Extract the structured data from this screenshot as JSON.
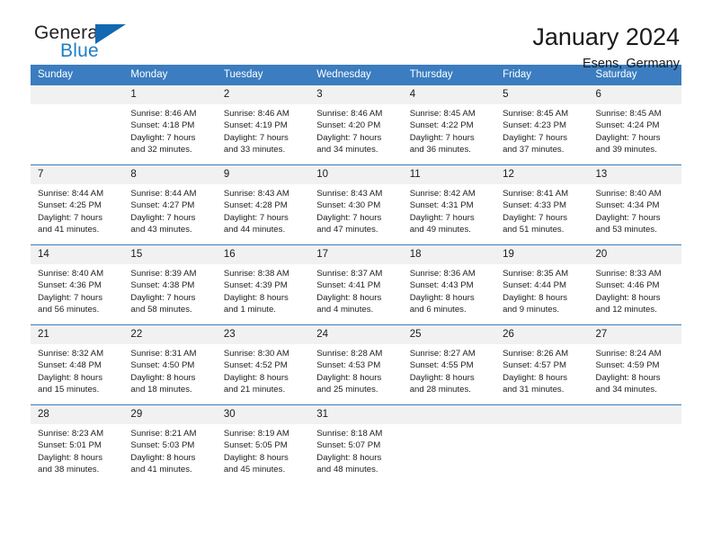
{
  "brand": {
    "name_part1": "General",
    "name_part2": "Blue",
    "accent_color": "#1268b3",
    "text_color": "#231f20"
  },
  "header": {
    "title": "January 2024",
    "subtitle": "Esens, Germany"
  },
  "calendar": {
    "header_bg": "#3b7dc0",
    "daynum_bg": "#f1f1f1",
    "weekdays": [
      "Sunday",
      "Monday",
      "Tuesday",
      "Wednesday",
      "Thursday",
      "Friday",
      "Saturday"
    ],
    "weeks": [
      [
        {
          "day": "",
          "blank": true
        },
        {
          "day": "1",
          "sunrise": "Sunrise: 8:46 AM",
          "sunset": "Sunset: 4:18 PM",
          "daylight_line1": "Daylight: 7 hours",
          "daylight_line2": "and 32 minutes."
        },
        {
          "day": "2",
          "sunrise": "Sunrise: 8:46 AM",
          "sunset": "Sunset: 4:19 PM",
          "daylight_line1": "Daylight: 7 hours",
          "daylight_line2": "and 33 minutes."
        },
        {
          "day": "3",
          "sunrise": "Sunrise: 8:46 AM",
          "sunset": "Sunset: 4:20 PM",
          "daylight_line1": "Daylight: 7 hours",
          "daylight_line2": "and 34 minutes."
        },
        {
          "day": "4",
          "sunrise": "Sunrise: 8:45 AM",
          "sunset": "Sunset: 4:22 PM",
          "daylight_line1": "Daylight: 7 hours",
          "daylight_line2": "and 36 minutes."
        },
        {
          "day": "5",
          "sunrise": "Sunrise: 8:45 AM",
          "sunset": "Sunset: 4:23 PM",
          "daylight_line1": "Daylight: 7 hours",
          "daylight_line2": "and 37 minutes."
        },
        {
          "day": "6",
          "sunrise": "Sunrise: 8:45 AM",
          "sunset": "Sunset: 4:24 PM",
          "daylight_line1": "Daylight: 7 hours",
          "daylight_line2": "and 39 minutes."
        }
      ],
      [
        {
          "day": "7",
          "sunrise": "Sunrise: 8:44 AM",
          "sunset": "Sunset: 4:25 PM",
          "daylight_line1": "Daylight: 7 hours",
          "daylight_line2": "and 41 minutes."
        },
        {
          "day": "8",
          "sunrise": "Sunrise: 8:44 AM",
          "sunset": "Sunset: 4:27 PM",
          "daylight_line1": "Daylight: 7 hours",
          "daylight_line2": "and 43 minutes."
        },
        {
          "day": "9",
          "sunrise": "Sunrise: 8:43 AM",
          "sunset": "Sunset: 4:28 PM",
          "daylight_line1": "Daylight: 7 hours",
          "daylight_line2": "and 44 minutes."
        },
        {
          "day": "10",
          "sunrise": "Sunrise: 8:43 AM",
          "sunset": "Sunset: 4:30 PM",
          "daylight_line1": "Daylight: 7 hours",
          "daylight_line2": "and 47 minutes."
        },
        {
          "day": "11",
          "sunrise": "Sunrise: 8:42 AM",
          "sunset": "Sunset: 4:31 PM",
          "daylight_line1": "Daylight: 7 hours",
          "daylight_line2": "and 49 minutes."
        },
        {
          "day": "12",
          "sunrise": "Sunrise: 8:41 AM",
          "sunset": "Sunset: 4:33 PM",
          "daylight_line1": "Daylight: 7 hours",
          "daylight_line2": "and 51 minutes."
        },
        {
          "day": "13",
          "sunrise": "Sunrise: 8:40 AM",
          "sunset": "Sunset: 4:34 PM",
          "daylight_line1": "Daylight: 7 hours",
          "daylight_line2": "and 53 minutes."
        }
      ],
      [
        {
          "day": "14",
          "sunrise": "Sunrise: 8:40 AM",
          "sunset": "Sunset: 4:36 PM",
          "daylight_line1": "Daylight: 7 hours",
          "daylight_line2": "and 56 minutes."
        },
        {
          "day": "15",
          "sunrise": "Sunrise: 8:39 AM",
          "sunset": "Sunset: 4:38 PM",
          "daylight_line1": "Daylight: 7 hours",
          "daylight_line2": "and 58 minutes."
        },
        {
          "day": "16",
          "sunrise": "Sunrise: 8:38 AM",
          "sunset": "Sunset: 4:39 PM",
          "daylight_line1": "Daylight: 8 hours",
          "daylight_line2": "and 1 minute."
        },
        {
          "day": "17",
          "sunrise": "Sunrise: 8:37 AM",
          "sunset": "Sunset: 4:41 PM",
          "daylight_line1": "Daylight: 8 hours",
          "daylight_line2": "and 4 minutes."
        },
        {
          "day": "18",
          "sunrise": "Sunrise: 8:36 AM",
          "sunset": "Sunset: 4:43 PM",
          "daylight_line1": "Daylight: 8 hours",
          "daylight_line2": "and 6 minutes."
        },
        {
          "day": "19",
          "sunrise": "Sunrise: 8:35 AM",
          "sunset": "Sunset: 4:44 PM",
          "daylight_line1": "Daylight: 8 hours",
          "daylight_line2": "and 9 minutes."
        },
        {
          "day": "20",
          "sunrise": "Sunrise: 8:33 AM",
          "sunset": "Sunset: 4:46 PM",
          "daylight_line1": "Daylight: 8 hours",
          "daylight_line2": "and 12 minutes."
        }
      ],
      [
        {
          "day": "21",
          "sunrise": "Sunrise: 8:32 AM",
          "sunset": "Sunset: 4:48 PM",
          "daylight_line1": "Daylight: 8 hours",
          "daylight_line2": "and 15 minutes."
        },
        {
          "day": "22",
          "sunrise": "Sunrise: 8:31 AM",
          "sunset": "Sunset: 4:50 PM",
          "daylight_line1": "Daylight: 8 hours",
          "daylight_line2": "and 18 minutes."
        },
        {
          "day": "23",
          "sunrise": "Sunrise: 8:30 AM",
          "sunset": "Sunset: 4:52 PM",
          "daylight_line1": "Daylight: 8 hours",
          "daylight_line2": "and 21 minutes."
        },
        {
          "day": "24",
          "sunrise": "Sunrise: 8:28 AM",
          "sunset": "Sunset: 4:53 PM",
          "daylight_line1": "Daylight: 8 hours",
          "daylight_line2": "and 25 minutes."
        },
        {
          "day": "25",
          "sunrise": "Sunrise: 8:27 AM",
          "sunset": "Sunset: 4:55 PM",
          "daylight_line1": "Daylight: 8 hours",
          "daylight_line2": "and 28 minutes."
        },
        {
          "day": "26",
          "sunrise": "Sunrise: 8:26 AM",
          "sunset": "Sunset: 4:57 PM",
          "daylight_line1": "Daylight: 8 hours",
          "daylight_line2": "and 31 minutes."
        },
        {
          "day": "27",
          "sunrise": "Sunrise: 8:24 AM",
          "sunset": "Sunset: 4:59 PM",
          "daylight_line1": "Daylight: 8 hours",
          "daylight_line2": "and 34 minutes."
        }
      ],
      [
        {
          "day": "28",
          "sunrise": "Sunrise: 8:23 AM",
          "sunset": "Sunset: 5:01 PM",
          "daylight_line1": "Daylight: 8 hours",
          "daylight_line2": "and 38 minutes."
        },
        {
          "day": "29",
          "sunrise": "Sunrise: 8:21 AM",
          "sunset": "Sunset: 5:03 PM",
          "daylight_line1": "Daylight: 8 hours",
          "daylight_line2": "and 41 minutes."
        },
        {
          "day": "30",
          "sunrise": "Sunrise: 8:19 AM",
          "sunset": "Sunset: 5:05 PM",
          "daylight_line1": "Daylight: 8 hours",
          "daylight_line2": "and 45 minutes."
        },
        {
          "day": "31",
          "sunrise": "Sunrise: 8:18 AM",
          "sunset": "Sunset: 5:07 PM",
          "daylight_line1": "Daylight: 8 hours",
          "daylight_line2": "and 48 minutes."
        },
        {
          "day": "",
          "blank": true
        },
        {
          "day": "",
          "blank": true
        },
        {
          "day": "",
          "blank": true
        }
      ]
    ]
  }
}
